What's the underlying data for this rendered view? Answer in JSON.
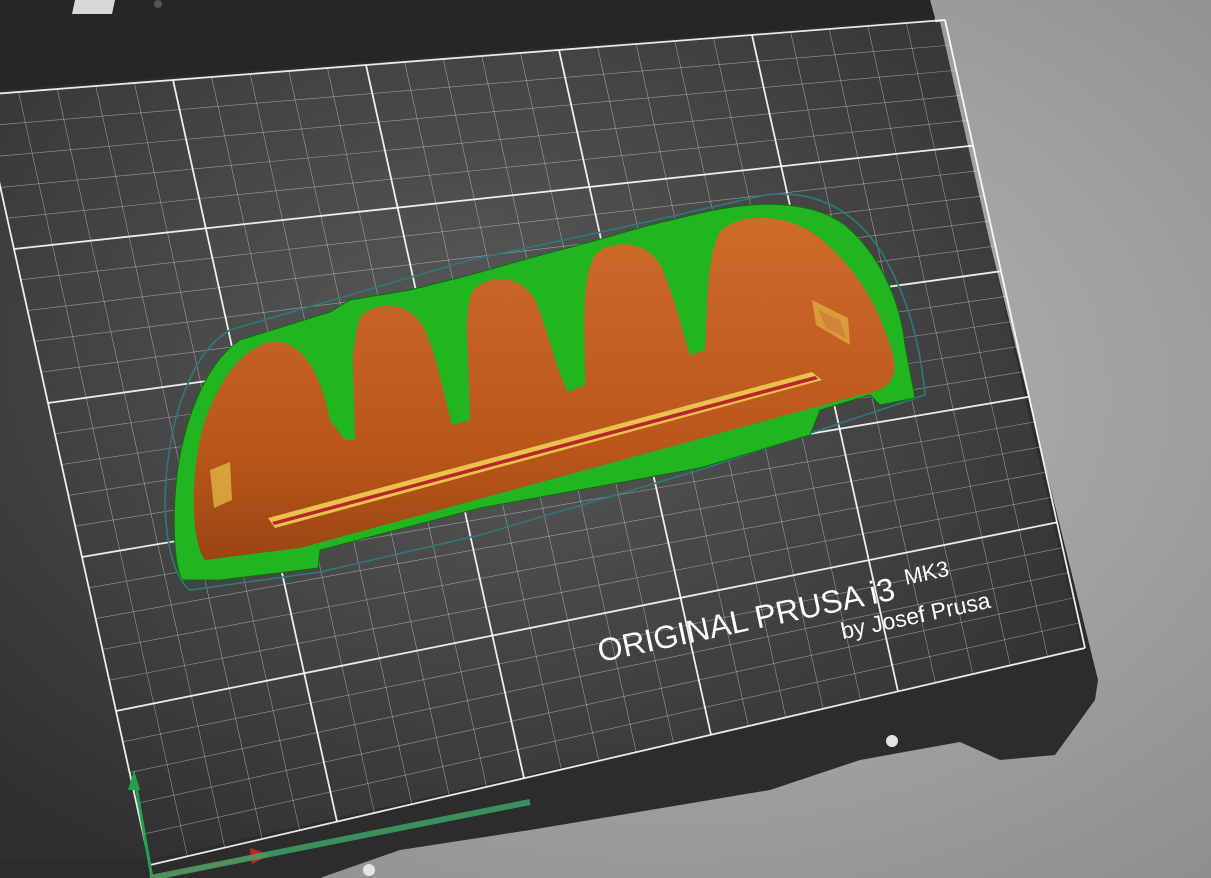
{
  "viewport": {
    "background_color": "#a2a2a2"
  },
  "bed": {
    "brand_text": "ORIGINAL PRUSA i3",
    "model_text": "MK3",
    "author_text": "by Josef Prusa",
    "plate_color": "#3b3b3b",
    "frame_color": "#2d2d2d",
    "grid_color": "#ffffff"
  },
  "model": {
    "object_color": "#c05a1c",
    "support_color": "#1fb21f",
    "skirt_color": "#2d7a7a",
    "top_layer_color": "#b7262a",
    "highlight_color": "#e8c24a"
  },
  "axes": {
    "x_axis_color": "#c32323",
    "y_axis_color": "#22a24a"
  }
}
